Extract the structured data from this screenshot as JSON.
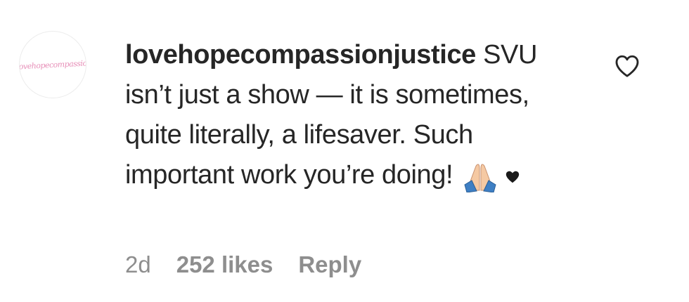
{
  "comment": {
    "avatar_text": "Lovehopecompassion",
    "username": "lovehopecompassionjustice",
    "text": "SVU isn’t just a show — it is sometimes, quite literally, a lifesaver. Such important work you’re doing!",
    "emojis": [
      "folded-hands-icon",
      "black-heart-icon"
    ],
    "time": "2d",
    "likes": "252 likes",
    "reply_label": "Reply",
    "like_icon": "heart-outline-icon"
  },
  "colors": {
    "text": "#262626",
    "muted": "#8e8e8e",
    "avatar_script": "#e78fb8"
  }
}
